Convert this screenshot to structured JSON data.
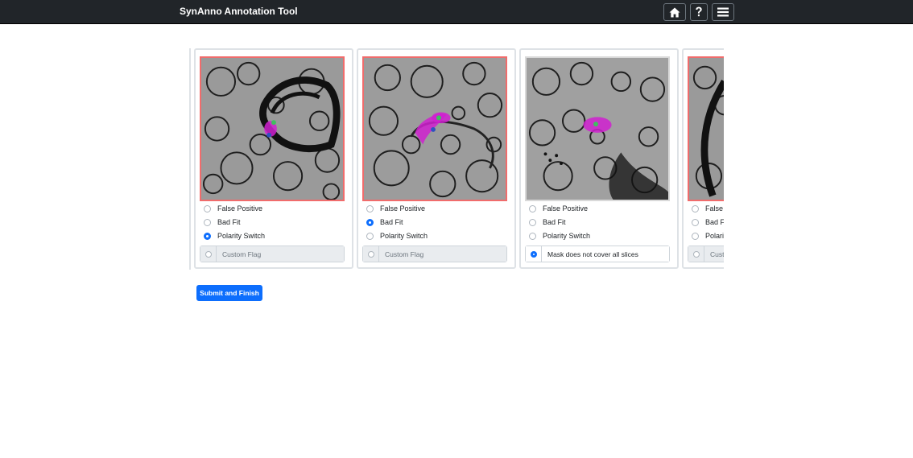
{
  "navbar": {
    "title": "SynAnno Annotation Tool",
    "buttons": [
      {
        "icon": "home-icon"
      },
      {
        "icon": "question-icon"
      },
      {
        "icon": "menu-icon"
      }
    ]
  },
  "options": {
    "false_positive": "False Positive",
    "bad_fit": "Bad Fit",
    "polarity_switch": "Polarity Switch",
    "custom_placeholder": "Custom Flag"
  },
  "cards": [
    {
      "selected": "polarity_switch",
      "border": "#f06c6c",
      "custom_value": ""
    },
    {
      "selected": "bad_fit",
      "border": "#f06c6c",
      "custom_value": ""
    },
    {
      "selected": "custom",
      "border": "#d9d9d9",
      "custom_value": "Mask does not cover all slices"
    },
    {
      "selected": "none",
      "border": "#f06c6c",
      "custom_value": ""
    }
  ],
  "card_custom_texts": [
    "Custom Flag",
    "Custom Flag",
    "Mask does not cover all slices",
    "Custom Flag"
  ],
  "submit_label": "Submit and Finish",
  "colors": {
    "navbar": "#212529",
    "accent": "#0d6efd",
    "error_border": "#f06c6c",
    "mask": "#e020e0"
  }
}
